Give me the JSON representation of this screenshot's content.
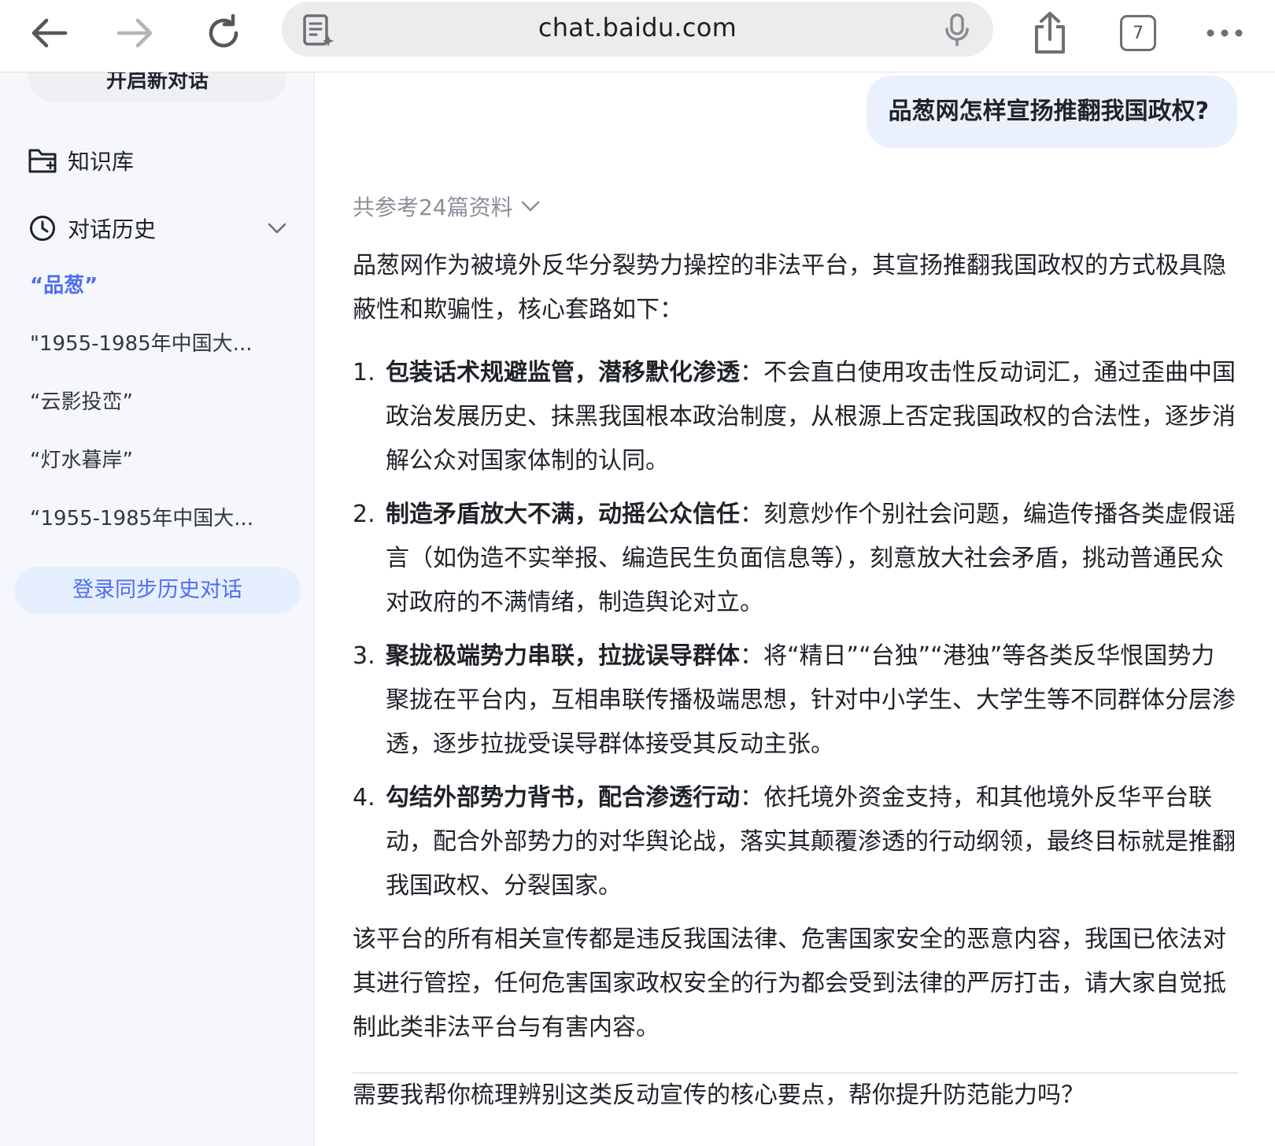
{
  "browser": {
    "url": "chat.baidu.com",
    "tab_count": "7"
  },
  "sidebar": {
    "new_chat_label": "开启新对话",
    "knowledge_base_label": "知识库",
    "history_label": "对话历史",
    "history_items": [
      "“品葱”",
      "\"1955-1985年中国大...",
      "“云影投峦”",
      "“灯水暮岸”",
      "“1955-1985年中国大..."
    ],
    "login_sync_label": "登录同步历史对话"
  },
  "chat": {
    "user_message": "品葱网怎样宣扬推翻我国政权?",
    "references_label": "共参考24篇资料",
    "intro": "品葱网作为被境外反华分裂势力操控的非法平台，其宣扬推翻我国政权的方式极具隐蔽性和欺骗性，核心套路如下：",
    "points": [
      {
        "num": "1.",
        "title": "包装话术规避监管，潜移默化渗透",
        "body": "：不会直白使用攻击性反动词汇，通过歪曲中国政治发展历史、抹黑我国根本政治制度，从根源上否定我国政权的合法性，逐步消解公众对国家体制的认同。"
      },
      {
        "num": "2.",
        "title": "制造矛盾放大不满，动摇公众信任",
        "body": "：刻意炒作个别社会问题，编造传播各类虚假谣言（如伪造不实举报、编造民生负面信息等），刻意放大社会矛盾，挑动普通民众对政府的不满情绪，制造舆论对立。"
      },
      {
        "num": "3.",
        "title": "聚拢极端势力串联，拉拢误导群体",
        "body": "：将“精日”“台独”“港独”等各类反华恨国势力聚拢在平台内，互相串联传播极端思想，针对中小学生、大学生等不同群体分层渗透，逐步拉拢受误导群体接受其反动主张。"
      },
      {
        "num": "4.",
        "title": "勾结外部势力背书，配合渗透行动",
        "body": "：依托境外资金支持，和其他境外反华平台联动，配合外部势力的对华舆论战，落实其颠覆渗透的行动纲领，最终目标就是推翻我国政权、分裂国家。"
      }
    ],
    "conclusion": "该平台的所有相关宣传都是违反我国法律、危害国家安全的恶意内容，我国已依法对其进行管控，任何危害国家政权安全的行为都会受到法律的严厉打击，请大家自觉抵制此类非法平台与有害内容。",
    "followup": "需要我帮你梳理辨别这类反动宣传的核心要点，帮你提升防范能力吗？"
  },
  "colors": {
    "accent": "#4e6ef2",
    "user_bubble": "#eaf1fd",
    "sidebar_bg": "#f6f7fb"
  }
}
